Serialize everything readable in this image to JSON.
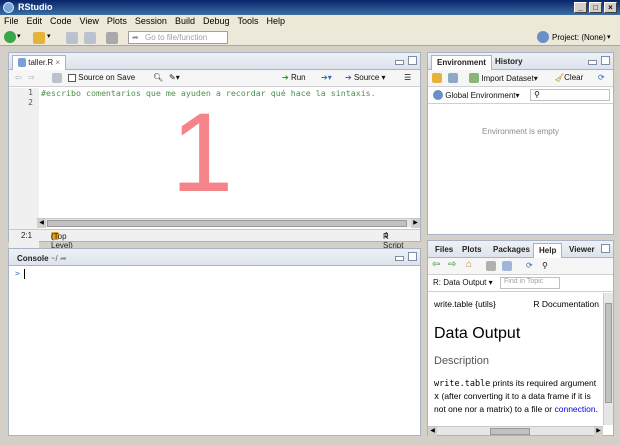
{
  "window": {
    "title": "RStudio",
    "min": "_",
    "max": "□",
    "close": "×"
  },
  "menu": [
    "File",
    "Edit",
    "Code",
    "View",
    "Plots",
    "Session",
    "Build",
    "Debug",
    "Tools",
    "Help"
  ],
  "toolbar": {
    "goto_placeholder": "Go to file/function",
    "project_label": "Project: (None)"
  },
  "editor": {
    "tab_label": "taller.R",
    "source_on_save": "Source on Save",
    "run_label": "Run",
    "source_label": "Source",
    "line_numbers": [
      "1",
      "2"
    ],
    "lines": [
      "#escribo comentarios que me ayuden a recordar qué hace la sintaxis.",
      ""
    ],
    "overlay_number": "1",
    "status_position": "2:1",
    "status_scope": "(Top Level)",
    "status_type": "R Script"
  },
  "console": {
    "tab_label": "Console",
    "path": "~/",
    "prompt": ">"
  },
  "environment": {
    "tabs": [
      "Environment",
      "History"
    ],
    "import_label": "Import Dataset",
    "clear_label": "Clear",
    "scope_label": "Global Environment",
    "empty_message": "Environment is empty"
  },
  "files_pane": {
    "tabs": [
      "Files",
      "Plots",
      "Packages",
      "Help",
      "Viewer"
    ],
    "topic_label": "R: Data Output",
    "find_placeholder": "Find in Topic",
    "doc_left": "write.table {utils}",
    "doc_right": "R Documentation",
    "heading": "Data Output",
    "subheading": "Description",
    "body_code": "write.table",
    "body_text_1": " prints its required argument ",
    "body_code_2": "x",
    "body_text_2": " (after converting it to a data frame if it is not one nor a matrix) to a file or ",
    "body_link": "connection",
    "body_end": "."
  },
  "colors": {
    "titlebar": "#0a246a",
    "comment": "#4e8f4e",
    "overlay": "#f4848a",
    "link": "#0000ee"
  },
  "icons": [
    "r-logo-icon",
    "new-file-icon",
    "open-folder-icon",
    "save-icon",
    "save-all-icon",
    "print-icon",
    "goto-arrow-icon",
    "project-icon",
    "back-arrow-icon",
    "forward-arrow-icon",
    "magnifier-icon",
    "wand-icon",
    "run-arrow-icon",
    "rerun-icon",
    "source-arrow-icon",
    "outline-icon",
    "broom-icon",
    "refresh-icon",
    "home-icon"
  ]
}
